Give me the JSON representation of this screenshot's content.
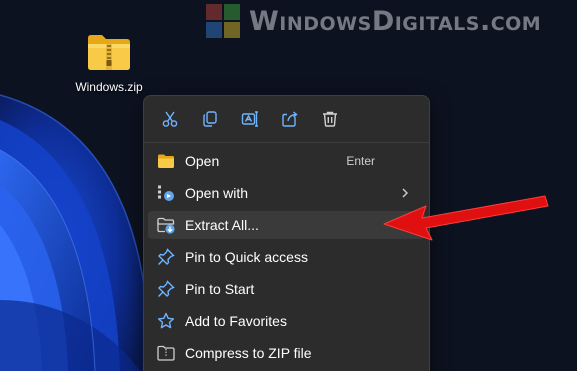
{
  "watermark": {
    "text": "WindowsDigitals.com"
  },
  "desktop_icon": {
    "label": "Windows.zip",
    "icon": "zip-folder-icon"
  },
  "context_menu": {
    "quick_actions": [
      {
        "name": "cut",
        "icon": "scissors-icon"
      },
      {
        "name": "copy",
        "icon": "copy-icon"
      },
      {
        "name": "rename",
        "icon": "rename-icon"
      },
      {
        "name": "share",
        "icon": "share-icon"
      },
      {
        "name": "delete",
        "icon": "trash-icon"
      }
    ],
    "items": [
      {
        "label": "Open",
        "shortcut": "Enter",
        "icon": "folder-open-icon"
      },
      {
        "label": "Open with",
        "icon": "open-with-icon",
        "submenu": true
      },
      {
        "label": "Extract All...",
        "icon": "extract-icon",
        "highlighted": true
      },
      {
        "label": "Pin to Quick access",
        "icon": "pin-icon"
      },
      {
        "label": "Pin to Start",
        "icon": "pin-icon"
      },
      {
        "label": "Add to Favorites",
        "icon": "star-icon"
      },
      {
        "label": "Compress to ZIP file",
        "icon": "zip-icon"
      }
    ]
  },
  "colors": {
    "menu_background": "#2c2c2c",
    "hover_background": "#3a3a3a",
    "accent_blue": "#60a5e8",
    "arrow_red": "#e01010"
  }
}
